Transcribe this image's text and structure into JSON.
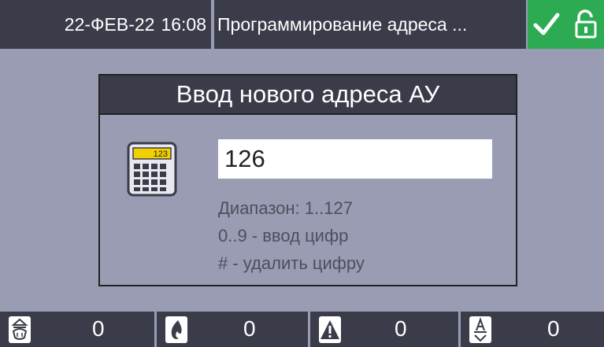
{
  "header": {
    "date": "22-ФЕВ-22",
    "time": "16:08",
    "title": "Программирование адреса ...",
    "status_icons": [
      "checkmark-icon",
      "unlocked-icon"
    ]
  },
  "dialog": {
    "title": "Ввод нового адреса АУ",
    "icon": "calculator-icon",
    "icon_display": "123",
    "value": "126",
    "hints": [
      "Диапазон: 1..127",
      "0..9 - ввод цифр",
      "# - удалить цифру"
    ]
  },
  "footer": {
    "counters": [
      {
        "icon": "sprinkler-icon",
        "value": "0"
      },
      {
        "icon": "fire-icon",
        "value": "0"
      },
      {
        "icon": "warning-icon",
        "value": "0"
      },
      {
        "icon": "automation-icon",
        "value": "0"
      }
    ]
  },
  "colors": {
    "background": "#9a9cb4",
    "bar": "#3a3c4a",
    "status_ok": "#2cab52",
    "display_yellow": "#f0d000"
  }
}
